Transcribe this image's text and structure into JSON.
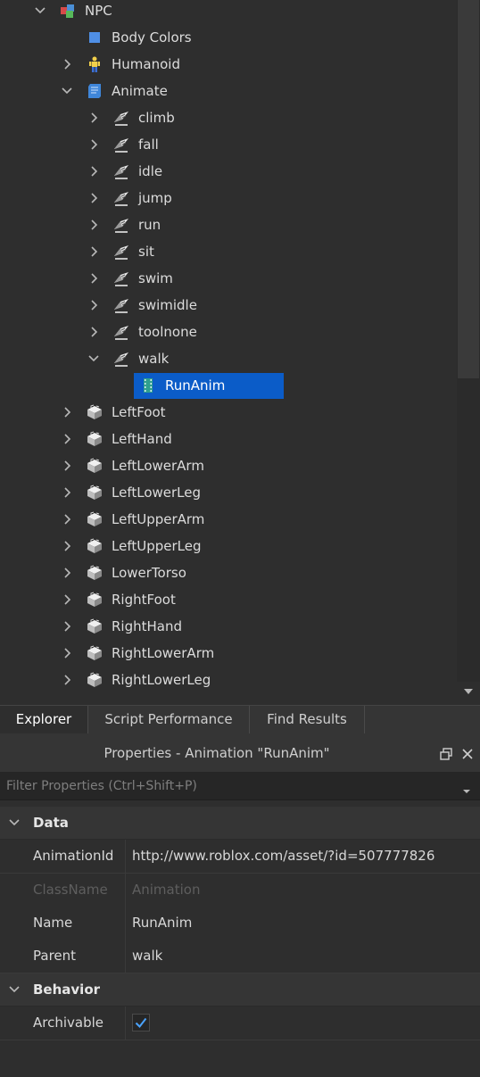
{
  "explorer": {
    "rows": [
      {
        "label": "NPC",
        "chevron": "down",
        "icon": "model-icon"
      },
      {
        "label": "Body Colors",
        "chevron": "none",
        "icon": "body-colors-icon"
      },
      {
        "label": "Humanoid",
        "chevron": "right",
        "icon": "humanoid-icon"
      },
      {
        "label": "Animate",
        "chevron": "down",
        "icon": "local-script-icon"
      },
      {
        "label": "climb",
        "chevron": "right",
        "icon": "string-value-icon"
      },
      {
        "label": "fall",
        "chevron": "right",
        "icon": "string-value-icon"
      },
      {
        "label": "idle",
        "chevron": "right",
        "icon": "string-value-icon"
      },
      {
        "label": "jump",
        "chevron": "right",
        "icon": "string-value-icon"
      },
      {
        "label": "run",
        "chevron": "right",
        "icon": "string-value-icon"
      },
      {
        "label": "sit",
        "chevron": "right",
        "icon": "string-value-icon"
      },
      {
        "label": "swim",
        "chevron": "right",
        "icon": "string-value-icon"
      },
      {
        "label": "swimidle",
        "chevron": "right",
        "icon": "string-value-icon"
      },
      {
        "label": "toolnone",
        "chevron": "right",
        "icon": "string-value-icon"
      },
      {
        "label": "walk",
        "chevron": "down",
        "icon": "string-value-icon"
      },
      {
        "label": "RunAnim",
        "chevron": "none",
        "icon": "animation-icon",
        "selected": true
      },
      {
        "label": "LeftFoot",
        "chevron": "right",
        "icon": "mesh-part-icon"
      },
      {
        "label": "LeftHand",
        "chevron": "right",
        "icon": "mesh-part-icon"
      },
      {
        "label": "LeftLowerArm",
        "chevron": "right",
        "icon": "mesh-part-icon"
      },
      {
        "label": "LeftLowerLeg",
        "chevron": "right",
        "icon": "mesh-part-icon"
      },
      {
        "label": "LeftUpperArm",
        "chevron": "right",
        "icon": "mesh-part-icon"
      },
      {
        "label": "LeftUpperLeg",
        "chevron": "right",
        "icon": "mesh-part-icon"
      },
      {
        "label": "LowerTorso",
        "chevron": "right",
        "icon": "mesh-part-icon"
      },
      {
        "label": "RightFoot",
        "chevron": "right",
        "icon": "mesh-part-icon"
      },
      {
        "label": "RightHand",
        "chevron": "right",
        "icon": "mesh-part-icon"
      },
      {
        "label": "RightLowerArm",
        "chevron": "right",
        "icon": "mesh-part-icon"
      },
      {
        "label": "RightLowerLeg",
        "chevron": "right",
        "icon": "mesh-part-icon"
      }
    ]
  },
  "tabs": {
    "explorer": "Explorer",
    "script_performance": "Script Performance",
    "find_results": "Find Results"
  },
  "properties": {
    "title": "Properties - Animation \"RunAnim\"",
    "filter_placeholder": "Filter Properties (Ctrl+Shift+P)",
    "sections": {
      "data": "Data",
      "behavior": "Behavior"
    },
    "data_props": {
      "animation_id": {
        "name": "AnimationId",
        "value": "http://www.roblox.com/asset/?id=507777826"
      },
      "class_name": {
        "name": "ClassName",
        "value": "Animation"
      },
      "name": {
        "name": "Name",
        "value": "RunAnim"
      },
      "parent": {
        "name": "Parent",
        "value": "walk"
      }
    },
    "behavior_props": {
      "archivable": {
        "name": "Archivable",
        "checked": true
      }
    }
  },
  "colors": {
    "background": "#2e2e2e",
    "selection": "#0b5cc8",
    "checkmark": "#4aa3ff"
  }
}
